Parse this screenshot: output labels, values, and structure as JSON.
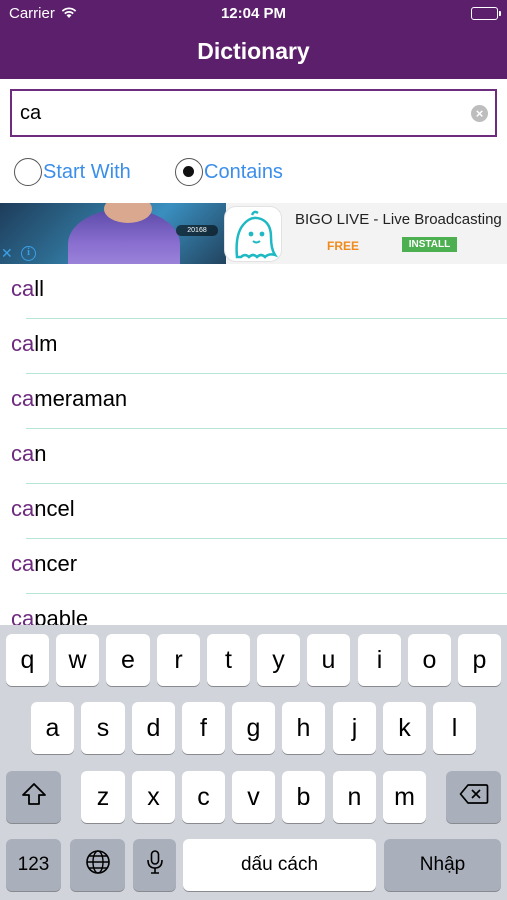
{
  "status_bar": {
    "carrier": "Carrier",
    "time": "12:04 PM",
    "wifi_icon": "wifi-icon",
    "battery_icon": "battery-icon"
  },
  "nav": {
    "title": "Dictionary",
    "background_color": "#5c1f6b"
  },
  "search": {
    "value": "ca",
    "placeholder": "",
    "clear_icon": "clear-icon"
  },
  "search_mode": {
    "options": [
      {
        "label": "Start With",
        "selected": false
      },
      {
        "label": "Contains",
        "selected": true
      }
    ]
  },
  "ad": {
    "close_icon": "close-icon",
    "info_icon": "info-icon",
    "app_icon": "ghost-app-icon",
    "app_name": "BIGO LIVE - Live Broadcasting",
    "price": "FREE",
    "install_label": "INSTALL",
    "photo_badge": "20168"
  },
  "results": {
    "query_match": "ca",
    "words": [
      {
        "match": "ca",
        "rest": "ll"
      },
      {
        "match": "ca",
        "rest": "lm"
      },
      {
        "match": "ca",
        "rest": "meraman"
      },
      {
        "match": "ca",
        "rest": "n"
      },
      {
        "match": "ca",
        "rest": "ncel"
      },
      {
        "match": "ca",
        "rest": "ncer"
      },
      {
        "match": "ca",
        "rest": "pable"
      }
    ],
    "match_color": "#6e2a7e",
    "separator_color": "#b8e6d6"
  },
  "keyboard": {
    "row1": [
      "q",
      "w",
      "e",
      "r",
      "t",
      "y",
      "u",
      "i",
      "o",
      "p"
    ],
    "row2": [
      "a",
      "s",
      "d",
      "f",
      "g",
      "h",
      "j",
      "k",
      "l"
    ],
    "row3": [
      "z",
      "x",
      "c",
      "v",
      "b",
      "n",
      "m"
    ],
    "shift_icon": "shift-icon",
    "delete_icon": "backspace-icon",
    "numbers_label": "123",
    "globe_icon": "globe-icon",
    "mic_icon": "microphone-icon",
    "space_label": "dấu cách",
    "return_label": "Nhập"
  }
}
